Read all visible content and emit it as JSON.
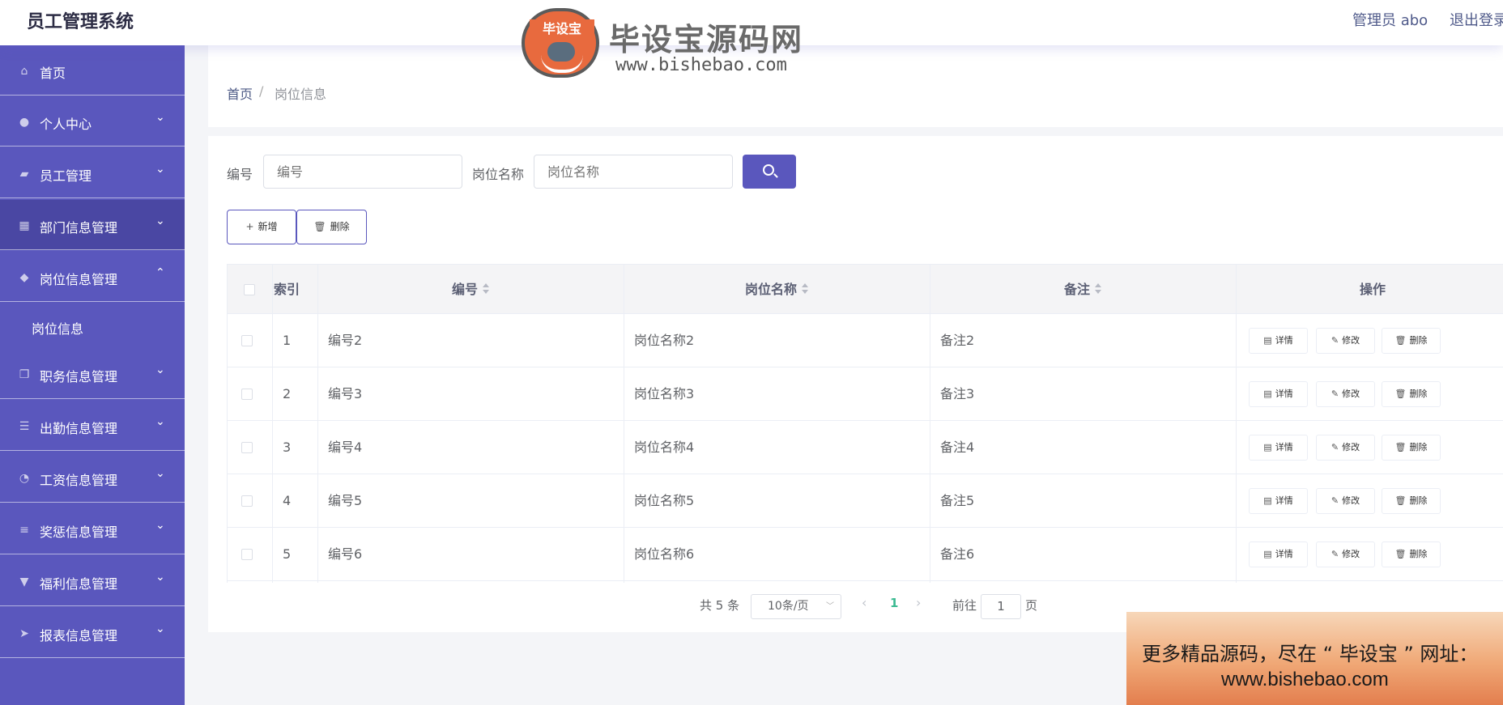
{
  "header": {
    "app_title": "员工管理系统",
    "user": "管理员 abo",
    "logout": "退出登录"
  },
  "watermark": {
    "badge": "毕设宝",
    "title": "毕设宝源码网",
    "url": "www.bishebao.com"
  },
  "sidebar": {
    "items": [
      {
        "label": "首页",
        "icon": "home-icon"
      },
      {
        "label": "个人中心",
        "icon": "user-icon"
      },
      {
        "label": "员工管理",
        "icon": "briefcase-icon"
      },
      {
        "label": "部门信息管理",
        "icon": "grid-icon"
      },
      {
        "label": "岗位信息管理",
        "icon": "location-icon"
      },
      {
        "label": "职务信息管理",
        "icon": "copy-icon"
      },
      {
        "label": "出勤信息管理",
        "icon": "list-icon"
      },
      {
        "label": "工资信息管理",
        "icon": "dashboard-icon"
      },
      {
        "label": "奖惩信息管理",
        "icon": "sliders-icon"
      },
      {
        "label": "福利信息管理",
        "icon": "brush-icon"
      },
      {
        "label": "报表信息管理",
        "icon": "send-icon"
      }
    ],
    "sub_items": [
      {
        "label": "岗位信息"
      }
    ]
  },
  "breadcrumb": {
    "home": "首页",
    "separator": "/",
    "current": "岗位信息"
  },
  "search": {
    "code_label": "编号",
    "code_placeholder": "编号",
    "name_label": "岗位名称",
    "name_placeholder": "岗位名称"
  },
  "toolbar": {
    "add_label": "新增",
    "delete_label": "删除"
  },
  "table": {
    "headers": {
      "index": "索引",
      "code": "编号",
      "name": "岗位名称",
      "remark": "备注",
      "actions": "操作"
    },
    "rows": [
      {
        "index": "1",
        "code": "编号2",
        "name": "岗位名称2",
        "remark": "备注2"
      },
      {
        "index": "2",
        "code": "编号3",
        "name": "岗位名称3",
        "remark": "备注3"
      },
      {
        "index": "3",
        "code": "编号4",
        "name": "岗位名称4",
        "remark": "备注4"
      },
      {
        "index": "4",
        "code": "编号5",
        "name": "岗位名称5",
        "remark": "备注5"
      },
      {
        "index": "5",
        "code": "编号6",
        "name": "岗位名称6",
        "remark": "备注6"
      }
    ],
    "actions": {
      "detail": "详情",
      "edit": "修改",
      "delete": "删除"
    }
  },
  "pagination": {
    "total": "共 5 条",
    "page_size": "10条/页",
    "current_page": "1",
    "goto_label": "前往",
    "goto_value": "1",
    "page_unit": "页"
  },
  "ad": {
    "line1": "更多精品源码，尽在 “ 毕设宝 ” 网址：",
    "line2": "www.bishebao.com"
  },
  "colors": {
    "primary": "#5a57bd",
    "sidebar_active": "#4a47a3",
    "page_number": "#3cba92"
  }
}
